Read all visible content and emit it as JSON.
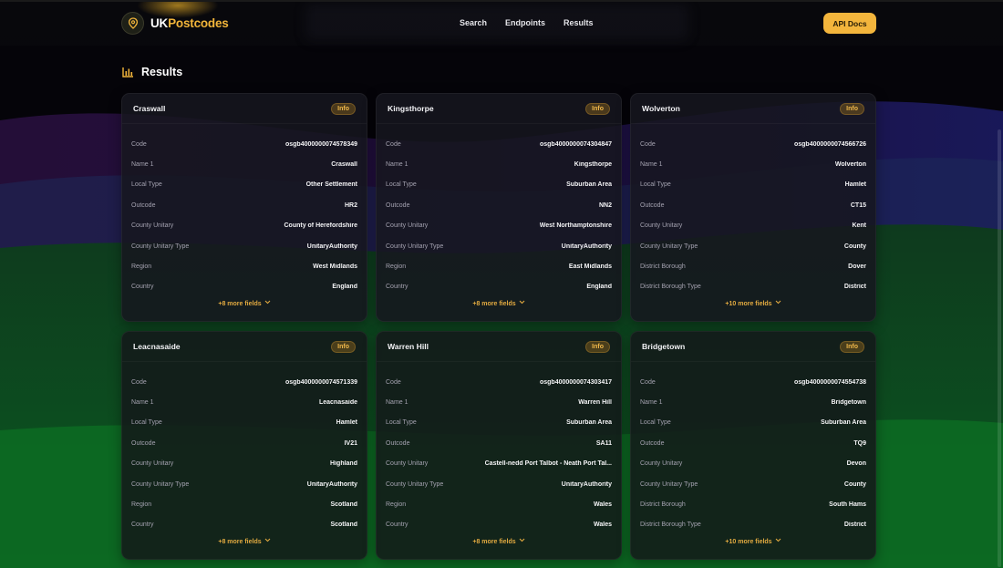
{
  "brand": {
    "uk": "UK",
    "rest": "Postcodes",
    "accent": "#f2b53a"
  },
  "nav": [
    "Search",
    "Endpoints",
    "Results"
  ],
  "api_button": "API Docs",
  "results_title": "Results",
  "info_label": "Info",
  "cards": [
    {
      "title": "Craswall",
      "more": "+8 more fields",
      "rows": [
        {
          "k": "Code",
          "v": "osgb4000000074578349"
        },
        {
          "k": "Name 1",
          "v": "Craswall"
        },
        {
          "k": "Local Type",
          "v": "Other Settlement"
        },
        {
          "k": "Outcode",
          "v": "HR2"
        },
        {
          "k": "County Unitary",
          "v": "County of Herefordshire"
        },
        {
          "k": "County Unitary Type",
          "v": "UnitaryAuthority"
        },
        {
          "k": "Region",
          "v": "West Midlands"
        },
        {
          "k": "Country",
          "v": "England"
        }
      ]
    },
    {
      "title": "Kingsthorpe",
      "more": "+8 more fields",
      "rows": [
        {
          "k": "Code",
          "v": "osgb4000000074304847"
        },
        {
          "k": "Name 1",
          "v": "Kingsthorpe"
        },
        {
          "k": "Local Type",
          "v": "Suburban Area"
        },
        {
          "k": "Outcode",
          "v": "NN2"
        },
        {
          "k": "County Unitary",
          "v": "West Northamptonshire"
        },
        {
          "k": "County Unitary Type",
          "v": "UnitaryAuthority"
        },
        {
          "k": "Region",
          "v": "East Midlands"
        },
        {
          "k": "Country",
          "v": "England"
        }
      ]
    },
    {
      "title": "Wolverton",
      "more": "+10 more fields",
      "rows": [
        {
          "k": "Code",
          "v": "osgb4000000074566726"
        },
        {
          "k": "Name 1",
          "v": "Wolverton"
        },
        {
          "k": "Local Type",
          "v": "Hamlet"
        },
        {
          "k": "Outcode",
          "v": "CT15"
        },
        {
          "k": "County Unitary",
          "v": "Kent"
        },
        {
          "k": "County Unitary Type",
          "v": "County"
        },
        {
          "k": "District Borough",
          "v": "Dover"
        },
        {
          "k": "District Borough Type",
          "v": "District"
        }
      ]
    },
    {
      "title": "Leacnasaide",
      "more": "+8 more fields",
      "rows": [
        {
          "k": "Code",
          "v": "osgb4000000074571339"
        },
        {
          "k": "Name 1",
          "v": "Leacnasaide"
        },
        {
          "k": "Local Type",
          "v": "Hamlet"
        },
        {
          "k": "Outcode",
          "v": "IV21"
        },
        {
          "k": "County Unitary",
          "v": "Highland"
        },
        {
          "k": "County Unitary Type",
          "v": "UnitaryAuthority"
        },
        {
          "k": "Region",
          "v": "Scotland"
        },
        {
          "k": "Country",
          "v": "Scotland"
        }
      ]
    },
    {
      "title": "Warren Hill",
      "more": "+8 more fields",
      "rows": [
        {
          "k": "Code",
          "v": "osgb4000000074303417"
        },
        {
          "k": "Name 1",
          "v": "Warren Hill"
        },
        {
          "k": "Local Type",
          "v": "Suburban Area"
        },
        {
          "k": "Outcode",
          "v": "SA11"
        },
        {
          "k": "County Unitary",
          "v": "Castell-nedd Port Talbot - Neath Port Tal..."
        },
        {
          "k": "County Unitary Type",
          "v": "UnitaryAuthority"
        },
        {
          "k": "Region",
          "v": "Wales"
        },
        {
          "k": "Country",
          "v": "Wales"
        }
      ]
    },
    {
      "title": "Bridgetown",
      "more": "+10 more fields",
      "rows": [
        {
          "k": "Code",
          "v": "osgb4000000074554738"
        },
        {
          "k": "Name 1",
          "v": "Bridgetown"
        },
        {
          "k": "Local Type",
          "v": "Suburban Area"
        },
        {
          "k": "Outcode",
          "v": "TQ9"
        },
        {
          "k": "County Unitary",
          "v": "Devon"
        },
        {
          "k": "County Unitary Type",
          "v": "County"
        },
        {
          "k": "District Borough",
          "v": "South Hams"
        },
        {
          "k": "District Borough Type",
          "v": "District"
        }
      ]
    }
  ]
}
